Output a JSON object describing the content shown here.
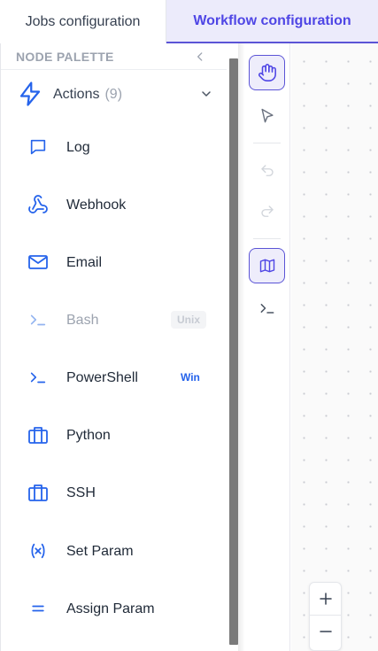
{
  "tabs": [
    {
      "label": "Jobs configuration",
      "active": false
    },
    {
      "label": "Workflow configuration",
      "active": true
    }
  ],
  "palette": {
    "title": "NODE PALETTE",
    "group": {
      "label": "Actions",
      "count": "(9)",
      "expanded": true
    },
    "nodes": [
      {
        "label": "Log",
        "icon": "message-square-icon",
        "disabled": false,
        "badge": ""
      },
      {
        "label": "Webhook",
        "icon": "webhook-icon",
        "disabled": false,
        "badge": ""
      },
      {
        "label": "Email",
        "icon": "mail-icon",
        "disabled": false,
        "badge": ""
      },
      {
        "label": "Bash",
        "icon": "terminal-icon",
        "disabled": true,
        "badge": "Unix"
      },
      {
        "label": "PowerShell",
        "icon": "terminal-icon",
        "disabled": false,
        "badge": "Win"
      },
      {
        "label": "Python",
        "icon": "briefcase-icon",
        "disabled": false,
        "badge": ""
      },
      {
        "label": "SSH",
        "icon": "briefcase-icon",
        "disabled": false,
        "badge": ""
      },
      {
        "label": "Set Param",
        "icon": "variable-icon",
        "disabled": false,
        "badge": ""
      },
      {
        "label": "Assign Param",
        "icon": "equals-icon",
        "disabled": false,
        "badge": ""
      }
    ]
  },
  "toolbar": {
    "tools": [
      {
        "name": "hand-tool",
        "icon": "hand-icon",
        "active": true
      },
      {
        "name": "select-tool",
        "icon": "cursor-icon",
        "active": false
      },
      {
        "name": "undo",
        "icon": "undo-icon",
        "active": false,
        "disabled": true
      },
      {
        "name": "redo",
        "icon": "redo-icon",
        "active": false,
        "disabled": true
      },
      {
        "name": "minimap",
        "icon": "map-icon",
        "active": true
      },
      {
        "name": "console",
        "icon": "terminal-icon",
        "active": false
      }
    ]
  },
  "zoom": {
    "in_label": "+",
    "out_label": "−"
  },
  "colors": {
    "accent": "#4f46e5",
    "icon_blue": "#2563eb",
    "muted": "#9ca3af",
    "tab_active_bg": "#ecebfb"
  }
}
